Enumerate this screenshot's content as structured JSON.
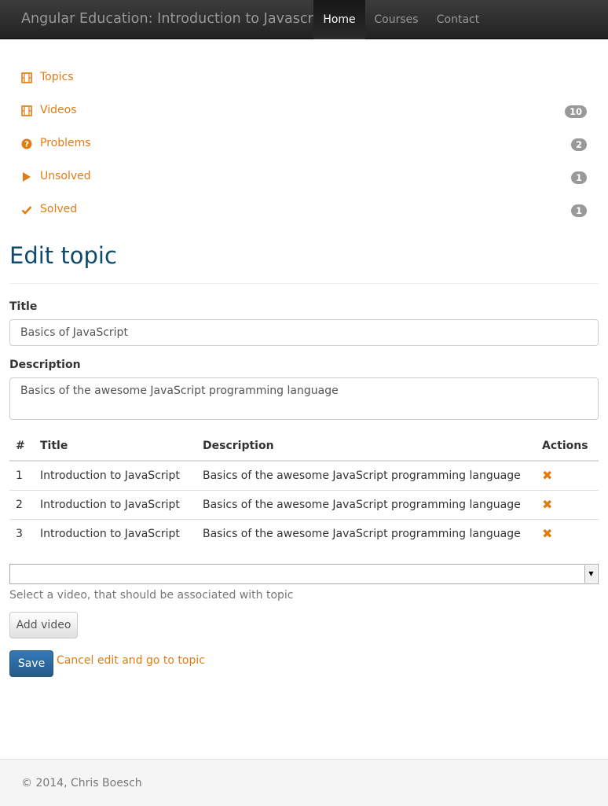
{
  "navbar": {
    "brand": "Angular Education: Introduction to Javascript",
    "items": [
      {
        "label": "Home",
        "active": true
      },
      {
        "label": "Courses",
        "active": false
      },
      {
        "label": "Contact",
        "active": false
      }
    ]
  },
  "sidebar": {
    "items": [
      {
        "label": "Topics",
        "icon": "film-icon",
        "badge": null
      },
      {
        "label": "Videos",
        "icon": "film-icon",
        "badge": "10"
      },
      {
        "label": "Problems",
        "icon": "question-circle-icon",
        "badge": "2"
      },
      {
        "label": "Unsolved",
        "icon": "play-icon",
        "badge": "1"
      },
      {
        "label": "Solved",
        "icon": "check-icon",
        "badge": "1"
      }
    ]
  },
  "page": {
    "title": "Edit topic"
  },
  "form": {
    "title_label": "Title",
    "title_value": "Basics of JavaScript",
    "description_label": "Description",
    "description_value": "Basics of the awesome JavaScript programming language"
  },
  "table": {
    "headers": [
      "#",
      "Title",
      "Description",
      "Actions"
    ],
    "rows": [
      {
        "num": "1",
        "title": "Introduction to JavaScript",
        "description": "Basics of the awesome JavaScript programming language",
        "action_icon": "remove-icon"
      },
      {
        "num": "2",
        "title": "Introduction to JavaScript",
        "description": "Basics of the awesome JavaScript programming language",
        "action_icon": "remove-icon"
      },
      {
        "num": "3",
        "title": "Introduction to JavaScript",
        "description": "Basics of the awesome JavaScript programming language",
        "action_icon": "remove-icon"
      }
    ]
  },
  "video_select": {
    "selected": "",
    "help_text": "Select a video, that should be associated with topic"
  },
  "buttons": {
    "add_video": "Add video",
    "save": "Save",
    "cancel_link": "Cancel edit and go to topic"
  },
  "footer": {
    "text": "© 2014, Chris Boesch"
  },
  "colors": {
    "accent": "#e17c12",
    "title": "#0c4a6e",
    "primary": "#337ab7"
  }
}
